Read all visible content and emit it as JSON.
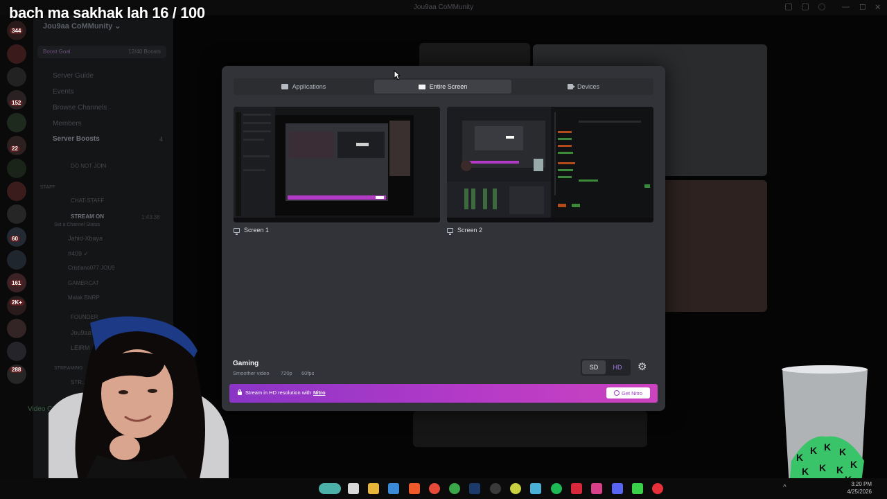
{
  "overlay": {
    "title": "bach ma sakhak lah 16 / 100"
  },
  "window": {
    "title": "Jou9aa CoMMunity",
    "min": "—",
    "max": "☐",
    "close": "✕"
  },
  "background_sidebar": {
    "guild_name": "Jou9aa CoMMunity ⌄",
    "boost_goal_label": "Boost Goal",
    "boost_goal_value": "12/40 Boosts",
    "items": [
      {
        "label": "Server Guide"
      },
      {
        "label": "Events"
      },
      {
        "label": "Browse Channels"
      },
      {
        "label": "Members"
      },
      {
        "label": "Server Boosts",
        "count": "4"
      },
      {
        "label": "DO NOT JOIN"
      },
      {
        "label": "STAFF"
      },
      {
        "label": "CHAT-STAFF"
      },
      {
        "label": "STREAM ON",
        "time": "1:43:38"
      },
      {
        "label": "Set a Channel Status"
      },
      {
        "label": "Jahid-Xbaya"
      },
      {
        "label": "#409 ✓"
      },
      {
        "label": "Cristiano077  JOU9"
      },
      {
        "label": "GAMERCAT"
      },
      {
        "label": "Malak  BNRP"
      },
      {
        "label": "FOUNDER"
      },
      {
        "label": "Jou9aa"
      },
      {
        "label": "LEIRM"
      },
      {
        "label": "STREAMING"
      },
      {
        "label": "STR..."
      },
      {
        "label": "Video Co..."
      }
    ],
    "server_badges": [
      "344",
      "152",
      "22",
      "60",
      "161",
      "2K+",
      "288"
    ]
  },
  "modal": {
    "tabs": [
      {
        "label": "Applications",
        "icon": "window-icon",
        "active": false
      },
      {
        "label": "Entire Screen",
        "icon": "monitor-icon",
        "active": true
      },
      {
        "label": "Devices",
        "icon": "camera-icon",
        "active": false
      }
    ],
    "sources": [
      {
        "label": "Screen 1",
        "icon": "monitor-icon"
      },
      {
        "label": "Screen 2",
        "icon": "monitor-icon"
      }
    ],
    "quality": {
      "title": "Gaming",
      "subtitle": "Smoother video",
      "resolution": "720p",
      "fps": "60fps",
      "sd_label": "SD",
      "hd_label": "HD",
      "selected": "SD"
    },
    "nitro": {
      "text": "Stream in HD resolution with",
      "link": "Nitro",
      "button": "Get Nitro"
    }
  },
  "taskbar": {
    "apps": [
      "water-bottle-icon",
      "file-explorer-icon",
      "folder-icon",
      "store-icon",
      "brave-icon",
      "chrome-icon",
      "xbox-icon",
      "steam-icon",
      "obs-icon",
      "app-icon",
      "image-viewer-icon",
      "spotify-icon",
      "adobe-icon",
      "instagram-icon",
      "discord-icon",
      "streamer-bot-icon",
      "opera-icon"
    ],
    "time": "3:20 PM",
    "date": "4/25/2026"
  },
  "colors": {
    "modal_bg": "#313338",
    "tab_active": "#3f4147",
    "nitro_gradient_start": "#8a35c7",
    "nitro_gradient_end": "#cc43bf",
    "hd_purple": "#a77cf0"
  }
}
